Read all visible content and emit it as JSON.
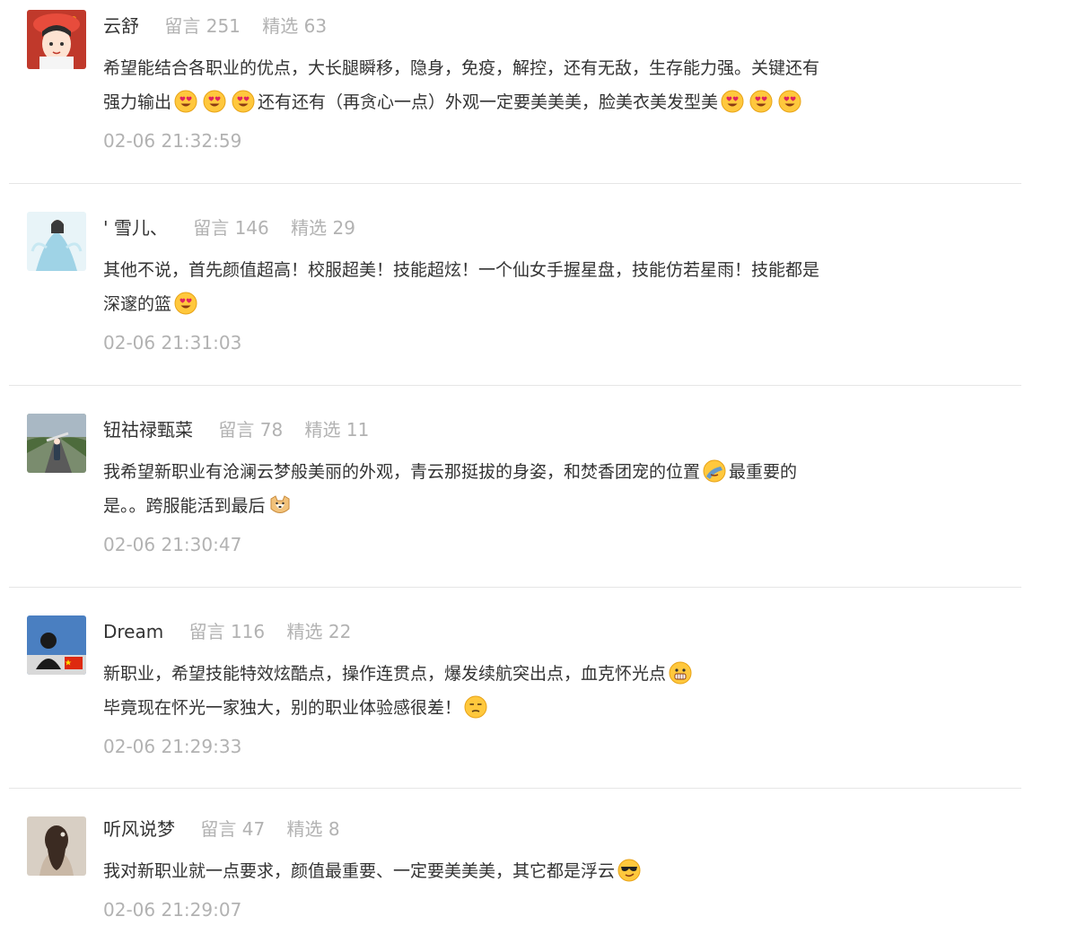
{
  "comments": [
    {
      "nickname": "云舒",
      "replies_label": "留言 251",
      "featured_label": "精选 63",
      "line1": "希望能结合各职业的优点，大长腿瞬移，隐身，免疫，解控，还有无敌，生存能力强。关键还有",
      "line2_a": "强力输出",
      "line2_b": "还有还有（再贪心一点）外观一定要美美美，脸美衣美发型美",
      "time": "02-06 21:32:59",
      "avatar_icon": "avatar-girl-red-hat"
    },
    {
      "nickname": "' 雪儿、",
      "replies_label": "留言 146",
      "featured_label": "精选 29",
      "line1": "其他不说，首先颜值超高！校服超美！技能超炫！一个仙女手握星盘，技能仿若星雨！技能都是",
      "line2_a": "深邃的篮",
      "time": "02-06 21:31:03",
      "avatar_icon": "avatar-fairy"
    },
    {
      "nickname": "钮祜禄甄菜",
      "replies_label": "留言 78",
      "featured_label": "精选 11",
      "line1_a": "我希望新职业有沧澜云梦般美丽的外观，青云那挺拔的身姿，和焚香团宠的位置",
      "line1_b": "最重要的",
      "line2_a": "是。。跨服能活到最后",
      "time": "02-06 21:30:47",
      "avatar_icon": "avatar-road"
    },
    {
      "nickname": "Dream",
      "replies_label": "留言 116",
      "featured_label": "精选 22",
      "line1_a": "新职业，希望技能特效炫酷点，操作连贯点，爆发续航突出点，血克怀光点",
      "line2_a": "毕竟现在怀光一家独大，别的职业体验感很差！",
      "time": "02-06 21:29:33",
      "avatar_icon": "avatar-blue-sky-flag"
    },
    {
      "nickname": "听风说梦",
      "replies_label": "留言 47",
      "featured_label": "精选 8",
      "line1_a": "我对新职业就一点要求，颜值最重要、一定要美美美，其它都是浮云",
      "time": "02-06 21:29:07",
      "avatar_icon": "avatar-girl-back"
    }
  ],
  "emoji": {
    "heart_eyes": "heart-eyes-emoji",
    "facepalm": "facepalm-emoji",
    "doge": "doge-emoji",
    "grimace": "grimace-emoji",
    "unamused": "unamused-emoji",
    "cool": "sunglasses-emoji"
  },
  "colors": {
    "text": "#333333",
    "muted": "#b2b2b2",
    "divider": "#e6e6e6"
  }
}
